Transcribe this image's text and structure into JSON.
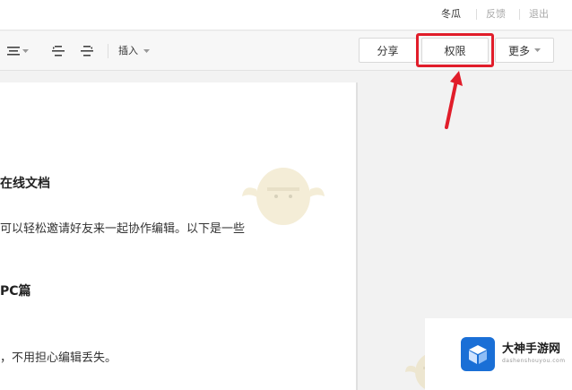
{
  "header": {
    "user_name": "冬瓜",
    "feedback_label": "反馈",
    "logout_label": "退出"
  },
  "toolbar": {
    "insert_label": "插入",
    "icons": [
      "align-icon",
      "indent-icon",
      "outdent-icon"
    ]
  },
  "actions": {
    "share_label": "分享",
    "permission_label": "权限",
    "more_label": "更多"
  },
  "document": {
    "heading_1": "在线文档",
    "paragraph_1": "可以轻松邀请好友来一起协作编辑。以下是一些",
    "heading_2": "PC篇",
    "paragraph_2": "，不用担心编辑丢失。"
  },
  "logo": {
    "title": "大神手游网",
    "url": "dashenshouyou.com"
  },
  "colors": {
    "highlight": "#e11d2a",
    "logo_blue": "#1a6fd6"
  }
}
